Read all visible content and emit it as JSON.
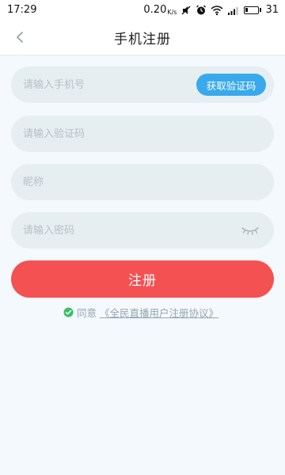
{
  "status_bar": {
    "time": "17:29",
    "speed_value": "0.20",
    "speed_unit": "K/s",
    "battery": "31"
  },
  "header": {
    "title": "手机注册"
  },
  "form": {
    "phone_placeholder": "请输入手机号",
    "get_code_label": "获取验证码",
    "code_placeholder": "请输入验证码",
    "nickname_placeholder": "昵称",
    "password_placeholder": "请输入密码",
    "register_label": "注册"
  },
  "agreement": {
    "prefix": "同意",
    "link_text": "《全民直播用户注册协议》"
  },
  "colors": {
    "accent_blue": "#39a9ec",
    "register_red": "#f45152",
    "check_green": "#3cbf63",
    "field_bg": "#e7eef2",
    "page_bg": "#f3f9fd"
  },
  "icons": {
    "back": "chevron-left-icon",
    "eye": "eye-closed-icon",
    "check": "check-circle-icon"
  }
}
